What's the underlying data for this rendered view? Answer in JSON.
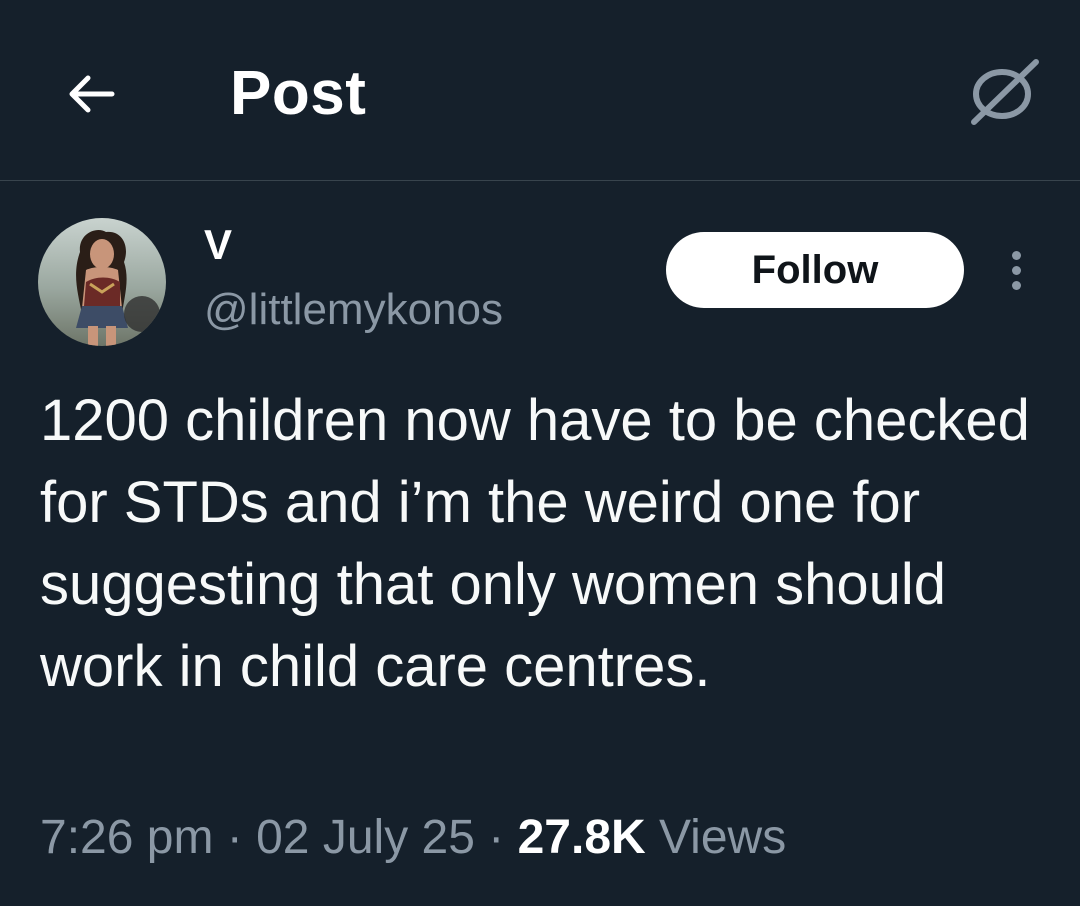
{
  "header": {
    "title": "Post",
    "back_icon": "arrow-left-icon",
    "grok_icon": "grok-slash-icon"
  },
  "author": {
    "display_name": "V",
    "handle": "@littlemykonos",
    "follow_label": "Follow",
    "more_icon": "more-vertical-icon"
  },
  "tweet": {
    "text": "1200 children now have to be checked for STDs and i’m the weird one for suggesting that only women should work in child care centres."
  },
  "meta": {
    "time": "7:26 pm",
    "separator": "·",
    "date": "02 July 25",
    "views_count": "27.8K",
    "views_label": "Views"
  },
  "colors": {
    "background": "#15202b",
    "muted_text": "#8b98a5",
    "divider": "#38444d",
    "follow_bg": "#ffffff"
  }
}
